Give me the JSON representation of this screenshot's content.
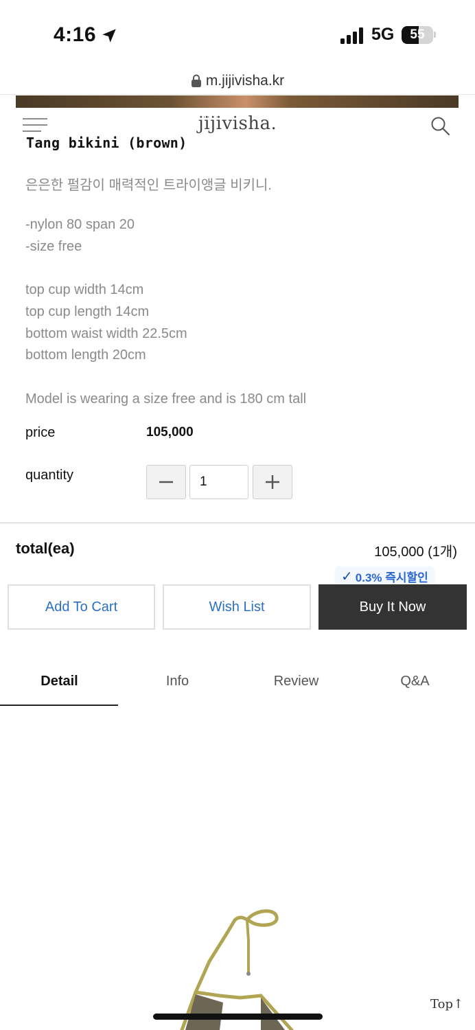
{
  "status_bar": {
    "time": "4:16",
    "network": "5G",
    "battery": "55",
    "battery_level": 0.55
  },
  "browser": {
    "url": "m.jijivisha.kr"
  },
  "header": {
    "logo": "jijivisha.",
    "logo_dots": "...."
  },
  "product": {
    "title": "Tang bikini (brown)",
    "description_lines": [
      "은은한 펄감이 매력적인 트라이앵글 비키니.",
      "-nylon 80 span 20",
      "-size free",
      "top cup width 14cm",
      "top cup length 14cm",
      "bottom waist width 22.5cm",
      "bottom length 20cm",
      "Model is wearing a size free and is 180 cm tall"
    ],
    "price_label": "price",
    "price_value": "105,000",
    "quantity_label": "quantity",
    "quantity_value": "1",
    "minus_symbol": "−",
    "plus_symbol": "+"
  },
  "total": {
    "label": "total(ea)",
    "value": "105,000 (1개)"
  },
  "badge": {
    "check": "✓",
    "text": "0.3% 즉시할인"
  },
  "actions": {
    "add_to_cart": "Add To Cart",
    "wish_list": "Wish List",
    "buy_now": "Buy It Now"
  },
  "tabs": [
    {
      "label": "Detail",
      "active": true
    },
    {
      "label": "Info",
      "active": false
    },
    {
      "label": "Review",
      "active": false
    },
    {
      "label": "Q&A",
      "active": false
    }
  ],
  "top_link": "Top↑",
  "colors": {
    "accent_blue": "#2b6fc4",
    "dark_button": "#333333",
    "muted_text": "#8a8a8a"
  },
  "icons": [
    "location-arrow-icon",
    "signal-bars-icon",
    "lock-icon",
    "hamburger-menu-icon",
    "search-icon"
  ]
}
